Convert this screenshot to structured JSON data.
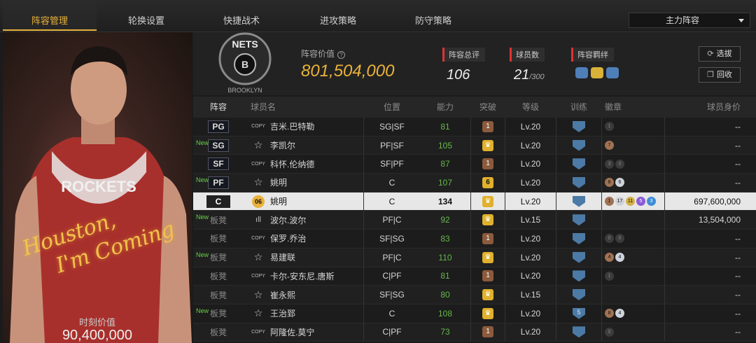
{
  "tabs": [
    {
      "label": "阵容管理",
      "active": true
    },
    {
      "label": "轮换设置",
      "active": false
    },
    {
      "label": "快捷战术",
      "active": false
    },
    {
      "label": "进攻策略",
      "active": false
    },
    {
      "label": "防守策略",
      "active": false
    }
  ],
  "lineup_selector": "主力阵容",
  "hero": {
    "slogan_line1": "Houston,",
    "slogan_line2": "I'm Coming",
    "jersey_text": "ROCKETS",
    "value_label": "时刻价值",
    "value": "90,400,000"
  },
  "summary": {
    "team_logo_text": "NETS",
    "team_logo_sub": "BROOKLYN",
    "lineup_value_label": "阵容价值",
    "lineup_value": "801,504,000",
    "overall_label": "阵容总评",
    "overall_value": "106",
    "player_count_label": "球员数",
    "player_count": "21",
    "player_count_max": "/300",
    "chemistry_label": "阵容羁绊",
    "chemistry_icons": [
      "team-people-icon",
      "gold-people-icon",
      "team-people-icon"
    ],
    "pick_button": "选拔",
    "recycle_button": "回收"
  },
  "table": {
    "headers": [
      "阵容",
      "球员名",
      "位置",
      "能力",
      "突破",
      "等级",
      "训练",
      "徽章",
      "球员身价"
    ],
    "rows": [
      {
        "slot": "PG",
        "bench": false,
        "new": "",
        "ptype": "COPY",
        "name": "吉米.巴特勒",
        "position": "SG|SF",
        "ability": "81",
        "breakthrough": "1",
        "brk_style": "copper",
        "level": "Lv.20",
        "train": "",
        "badges": [
          [
            "b-dk",
            "1"
          ]
        ],
        "worth": "--"
      },
      {
        "slot": "SG",
        "bench": false,
        "new": "New",
        "ptype": "☆",
        "name": "李凯尔",
        "position": "PF|SF",
        "ability": "105",
        "breakthrough": "♛",
        "brk_style": "gold",
        "level": "Lv.20",
        "train": "",
        "badges": [
          [
            "b-br",
            "7"
          ]
        ],
        "worth": "--"
      },
      {
        "slot": "SF",
        "bench": false,
        "new": "",
        "ptype": "COPY",
        "name": "科怀.伦纳德",
        "position": "SF|PF",
        "ability": "87",
        "breakthrough": "1",
        "brk_style": "copper",
        "level": "Lv.20",
        "train": "",
        "badges": [
          [
            "b-dk",
            "3"
          ],
          [
            "b-dk",
            "0"
          ]
        ],
        "worth": "--"
      },
      {
        "slot": "PF",
        "bench": false,
        "new": "New",
        "ptype": "☆",
        "name": "姚明",
        "position": "C",
        "ability": "107",
        "breakthrough": "6",
        "brk_style": "goldn",
        "level": "Lv.20",
        "train": "",
        "badges": [
          [
            "b-br",
            "8"
          ],
          [
            "b-sv",
            "6"
          ]
        ],
        "worth": "--"
      },
      {
        "slot": "C",
        "bench": false,
        "new": "",
        "ptype": "06",
        "name": "姚明",
        "position": "C",
        "ability": "134",
        "breakthrough": "♛",
        "brk_style": "gold",
        "level": "Lv.20",
        "train": "",
        "badges": [
          [
            "b-br",
            "1"
          ],
          [
            "b-sv",
            "17"
          ],
          [
            "b-gd",
            "11"
          ],
          [
            "b-pu",
            "5"
          ],
          [
            "b-bl",
            "3"
          ]
        ],
        "worth": "697,600,000",
        "selected": true
      },
      {
        "slot": "板凳",
        "bench": true,
        "new": "New",
        "ptype": "ıll",
        "name": "波尔.波尔",
        "position": "PF|C",
        "ability": "92",
        "breakthrough": "♛",
        "brk_style": "gold",
        "level": "Lv.15",
        "train": "",
        "badges": [],
        "worth": "13,504,000"
      },
      {
        "slot": "板凳",
        "bench": true,
        "new": "",
        "ptype": "COPY",
        "name": "保罗.乔治",
        "position": "SF|SG",
        "ability": "83",
        "breakthrough": "1",
        "brk_style": "copper",
        "level": "Lv.20",
        "train": "",
        "badges": [
          [
            "b-dk",
            "0"
          ],
          [
            "b-dk",
            "0"
          ]
        ],
        "worth": "--"
      },
      {
        "slot": "板凳",
        "bench": true,
        "new": "New",
        "ptype": "☆",
        "name": "易建联",
        "position": "PF|C",
        "ability": "110",
        "breakthrough": "♛",
        "brk_style": "gold",
        "level": "Lv.20",
        "train": "",
        "badges": [
          [
            "b-br",
            "4"
          ],
          [
            "b-sv",
            "4"
          ]
        ],
        "worth": "--"
      },
      {
        "slot": "板凳",
        "bench": true,
        "new": "",
        "ptype": "COPY",
        "name": "卡尔-安东尼.唐斯",
        "position": "C|PF",
        "ability": "81",
        "breakthrough": "1",
        "brk_style": "copper",
        "level": "Lv.20",
        "train": "",
        "badges": [
          [
            "b-dk",
            "1"
          ]
        ],
        "worth": "--"
      },
      {
        "slot": "板凳",
        "bench": true,
        "new": "",
        "ptype": "☆",
        "name": "崔永熙",
        "position": "SF|SG",
        "ability": "80",
        "breakthrough": "♛",
        "brk_style": "gold",
        "level": "Lv.15",
        "train": "",
        "badges": [],
        "worth": "--"
      },
      {
        "slot": "板凳",
        "bench": true,
        "new": "New",
        "ptype": "☆",
        "name": "王治郅",
        "position": "C",
        "ability": "108",
        "breakthrough": "♛",
        "brk_style": "gold",
        "level": "Lv.20",
        "train": "5",
        "badges": [
          [
            "b-br",
            "8"
          ],
          [
            "b-sv",
            "4"
          ]
        ],
        "worth": "--"
      },
      {
        "slot": "板凳",
        "bench": true,
        "new": "",
        "ptype": "COPY",
        "name": "阿隆佐.莫宁",
        "position": "C|PF",
        "ability": "73",
        "breakthrough": "1",
        "brk_style": "copper",
        "level": "Lv.20",
        "train": "",
        "badges": [
          [
            "b-dk",
            "0"
          ]
        ],
        "worth": "--"
      }
    ]
  }
}
